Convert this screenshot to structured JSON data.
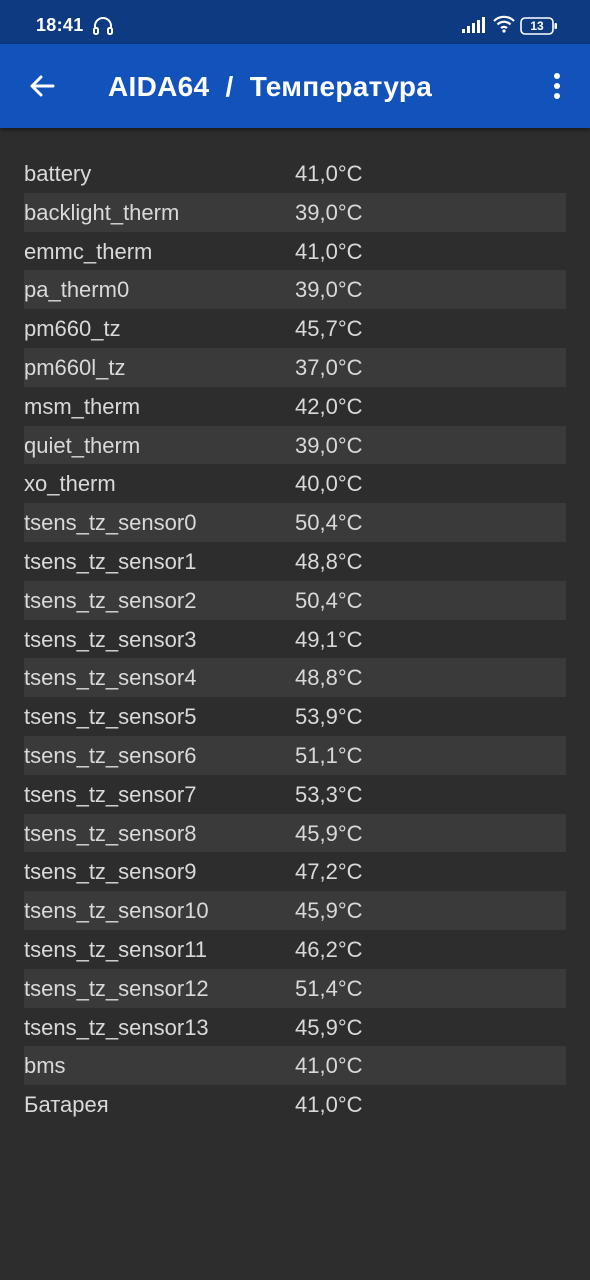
{
  "status_bar": {
    "time": "18:41",
    "battery_level": "13",
    "icons": [
      "headset-icon",
      "signal-icon",
      "wifi-icon",
      "battery-icon"
    ]
  },
  "app_bar": {
    "title": "AIDA64  /  Температура",
    "back_icon": "arrow-back-icon",
    "menu_icon": "more-vert-icon"
  },
  "colors": {
    "status_bar": "#0d3a80",
    "app_bar": "#1153ba",
    "background": "#2d2d2d",
    "row_alt": "#3a3a3a",
    "text": "#d9d9d9"
  },
  "sensors": [
    {
      "name": "battery",
      "value": "41,0°C"
    },
    {
      "name": "backlight_therm",
      "value": "39,0°C"
    },
    {
      "name": "emmc_therm",
      "value": "41,0°C"
    },
    {
      "name": "pa_therm0",
      "value": "39,0°C"
    },
    {
      "name": "pm660_tz",
      "value": "45,7°C"
    },
    {
      "name": "pm660l_tz",
      "value": "37,0°C"
    },
    {
      "name": "msm_therm",
      "value": "42,0°C"
    },
    {
      "name": "quiet_therm",
      "value": "39,0°C"
    },
    {
      "name": "xo_therm",
      "value": "40,0°C"
    },
    {
      "name": "tsens_tz_sensor0",
      "value": "50,4°C"
    },
    {
      "name": "tsens_tz_sensor1",
      "value": "48,8°C"
    },
    {
      "name": "tsens_tz_sensor2",
      "value": "50,4°C"
    },
    {
      "name": "tsens_tz_sensor3",
      "value": "49,1°C"
    },
    {
      "name": "tsens_tz_sensor4",
      "value": "48,8°C"
    },
    {
      "name": "tsens_tz_sensor5",
      "value": "53,9°C"
    },
    {
      "name": "tsens_tz_sensor6",
      "value": "51,1°C"
    },
    {
      "name": "tsens_tz_sensor7",
      "value": "53,3°C"
    },
    {
      "name": "tsens_tz_sensor8",
      "value": "45,9°C"
    },
    {
      "name": "tsens_tz_sensor9",
      "value": "47,2°C"
    },
    {
      "name": "tsens_tz_sensor10",
      "value": "45,9°C"
    },
    {
      "name": "tsens_tz_sensor11",
      "value": "46,2°C"
    },
    {
      "name": "tsens_tz_sensor12",
      "value": "51,4°C"
    },
    {
      "name": "tsens_tz_sensor13",
      "value": "45,9°C"
    },
    {
      "name": "bms",
      "value": "41,0°C"
    },
    {
      "name": "Батарея",
      "value": "41,0°C"
    }
  ]
}
